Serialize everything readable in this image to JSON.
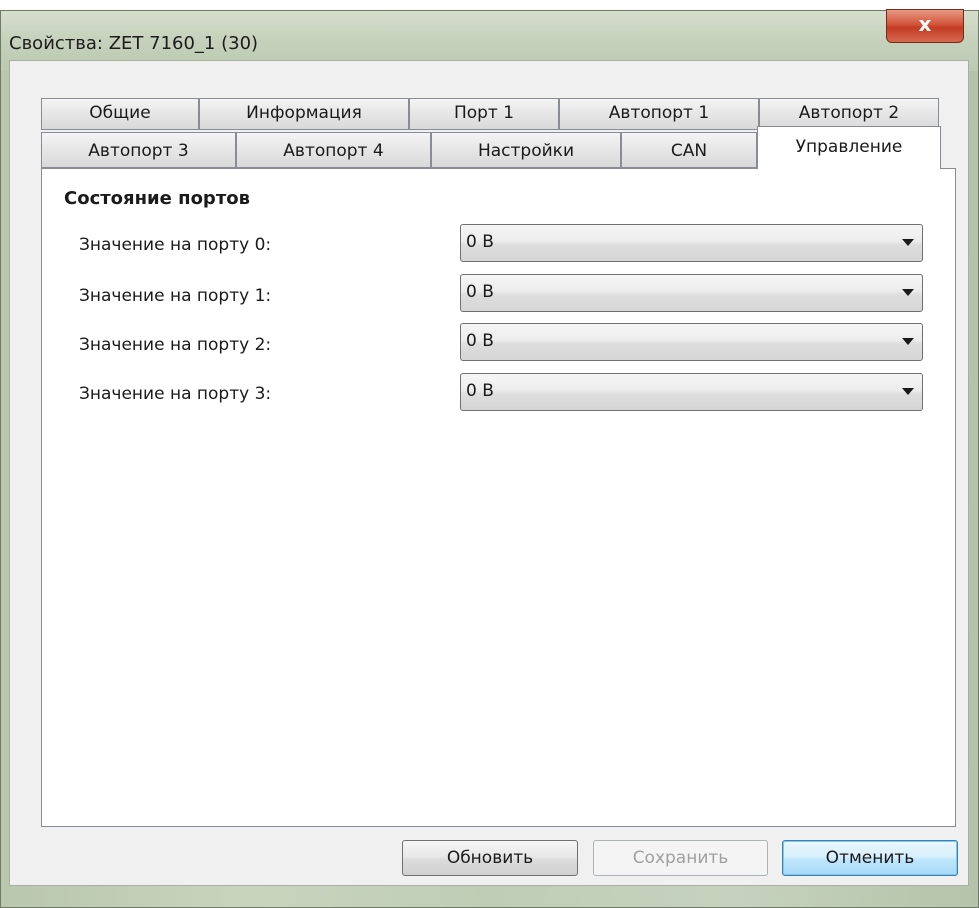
{
  "window": {
    "title": "Свойства: ZET 7160_1 (30)",
    "close_label": "x"
  },
  "tabs": {
    "row1": [
      "Общие",
      "Информация",
      "Порт 1",
      "Автопорт 1",
      "Автопорт 2"
    ],
    "row2": [
      "Автопорт 3",
      "Автопорт 4",
      "Настройки",
      "CAN",
      "Управление"
    ],
    "active": "Управление"
  },
  "panel": {
    "section_title": "Состояние портов",
    "rows": [
      {
        "label": "Значение на порту 0:",
        "value": "0 В"
      },
      {
        "label": "Значение на порту 1:",
        "value": "0 В"
      },
      {
        "label": "Значение на порту 2:",
        "value": "0 В"
      },
      {
        "label": "Значение на порту 3:",
        "value": "0 В"
      }
    ]
  },
  "buttons": {
    "refresh": "Обновить",
    "save": "Сохранить",
    "cancel": "Отменить"
  }
}
